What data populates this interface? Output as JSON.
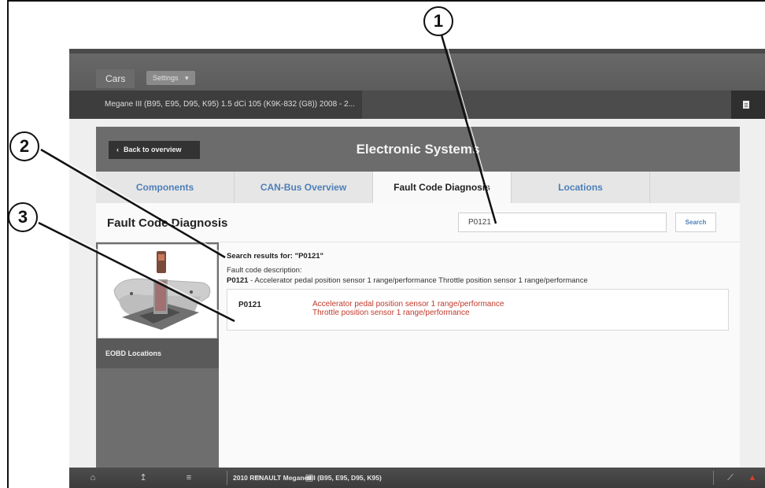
{
  "callouts": [
    "1",
    "2",
    "3"
  ],
  "topbar": {
    "cars_tab": "Cars",
    "settings_label": "Settings",
    "settings_caret": "▾"
  },
  "vehicle_bar": {
    "label": "Megane III (B95, E95, D95, K95) 1.5 dCi 105 (K9K-832 (G8)) 2008 - 2..."
  },
  "header": {
    "back_label": "Back to overview",
    "title": "Electronic Systems"
  },
  "tabs": [
    {
      "label": "Components",
      "active": false
    },
    {
      "label": "CAN-Bus Overview",
      "active": false
    },
    {
      "label": "Fault Code Diagnosis",
      "active": true
    },
    {
      "label": "Locations",
      "active": false
    }
  ],
  "panel": {
    "title": "Fault Code Diagnosis",
    "search_value": "P0121",
    "search_button": "Search",
    "side_label": "EOBD Locations"
  },
  "results": {
    "heading": "Search results for: \"P0121\"",
    "desc_label": "Fault code description:",
    "desc_code": "P0121",
    "desc_text": " - Accelerator pedal position sensor 1 range/performance Throttle position sensor 1 range/performance",
    "box_code": "P0121",
    "box_line1": "Accelerator pedal position sensor 1 range/performance",
    "box_line2": "Throttle position sensor 1 range/performance"
  },
  "bottom_bar": {
    "label": "2010 RENAULT Megane III (B95, E95, D95, K95)"
  },
  "colors": {
    "link_blue": "#4d7fb8",
    "fault_red": "#c0392b",
    "header_gray": "#6c6c6c"
  },
  "icons": [
    "home-icon",
    "upload-icon",
    "list-icon",
    "export-icon",
    "folder-icon",
    "pencil-icon",
    "wrench-icon",
    "document-icon"
  ]
}
